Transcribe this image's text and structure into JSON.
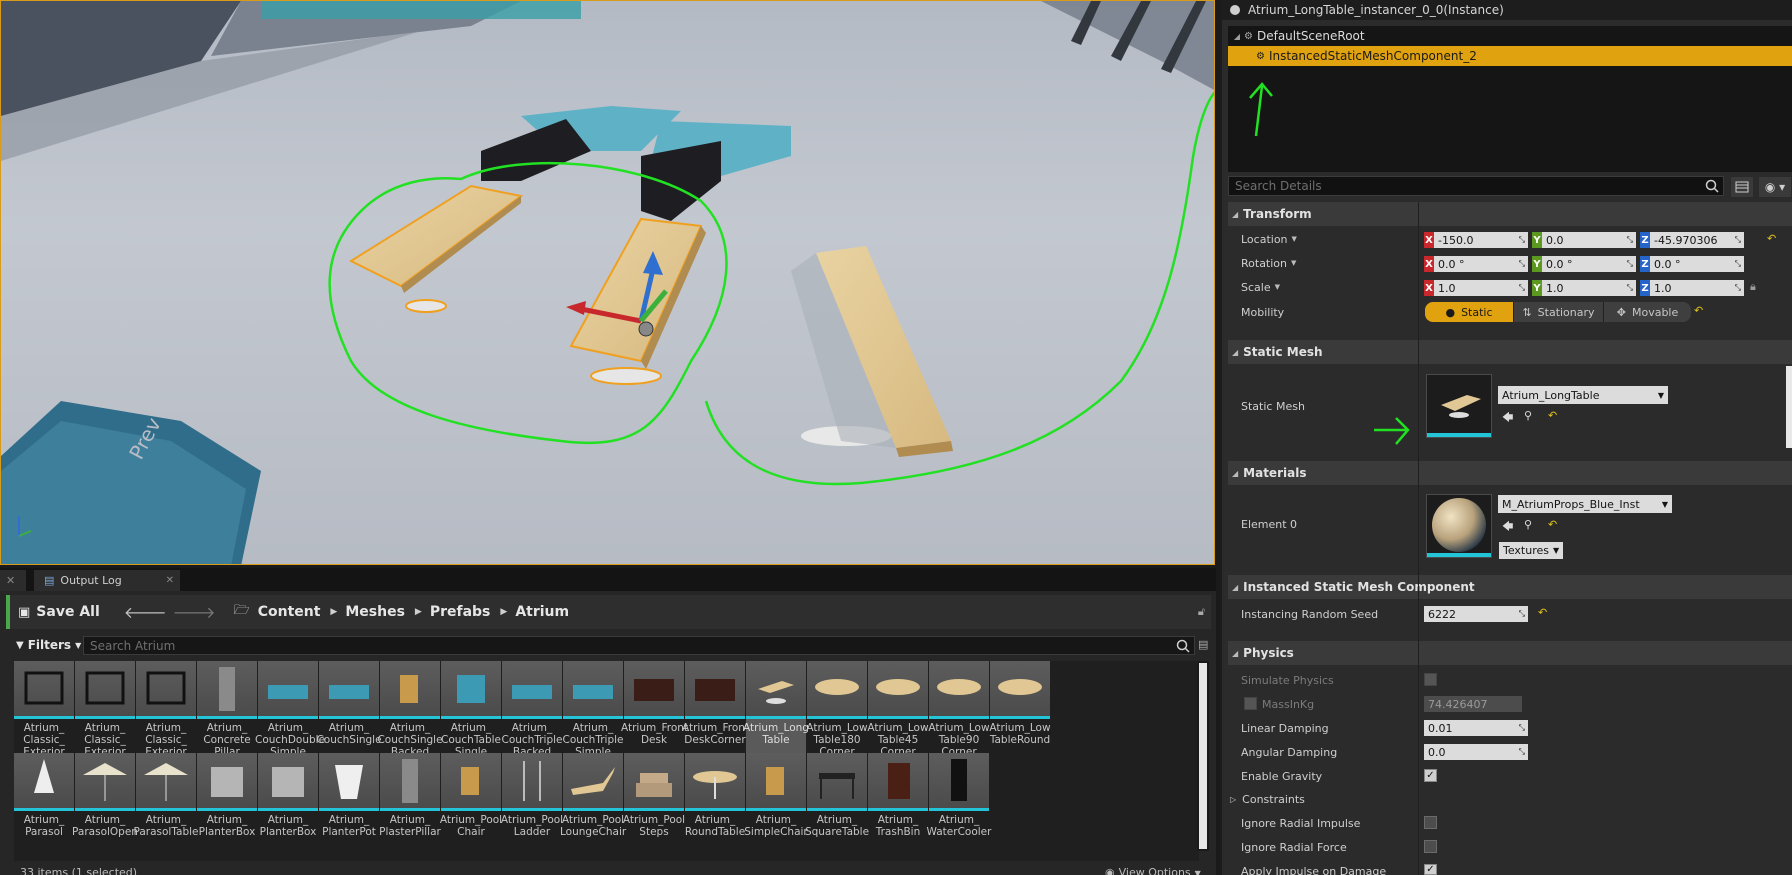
{
  "component_panel": {
    "actor_name": "Atrium_LongTable_instancer_0_0(Instance)",
    "tree": [
      {
        "label": "DefaultSceneRoot"
      },
      {
        "label": "InstancedStaticMeshComponent_2"
      }
    ]
  },
  "details": {
    "search_placeholder": "Search Details",
    "transform": {
      "header": "Transform",
      "location_label": "Location",
      "rotation_label": "Rotation",
      "scale_label": "Scale",
      "mobility_label": "Mobility",
      "location": {
        "x": "-150.0",
        "y": "0.0",
        "z": "-45.970306"
      },
      "rotation": {
        "x": "0.0 °",
        "y": "0.0 °",
        "z": "0.0 °"
      },
      "scale": {
        "x": "1.0",
        "y": "1.0",
        "z": "1.0"
      },
      "mobility_options": [
        "Static",
        "Stationary",
        "Movable"
      ],
      "mobility_selected": "Static"
    },
    "static_mesh": {
      "header": "Static Mesh",
      "label": "Static Mesh",
      "value": "Atrium_LongTable"
    },
    "materials": {
      "header": "Materials",
      "element_label": "Element 0",
      "value": "M_AtriumProps_Blue_Inst",
      "textures_label": "Textures"
    },
    "instanced": {
      "header": "Instanced Static Mesh Component",
      "seed_label": "Instancing Random Seed",
      "seed_value": "6222"
    },
    "physics": {
      "header": "Physics",
      "simulate_label": "Simulate Physics",
      "mass_label": "MassInKg",
      "mass_value": "74.426407",
      "linear_label": "Linear Damping",
      "linear_value": "0.01",
      "angular_label": "Angular Damping",
      "angular_value": "0.0",
      "gravity_label": "Enable Gravity",
      "constraints_label": "Constraints",
      "radial_impulse_label": "Ignore Radial Impulse",
      "radial_force_label": "Ignore Radial Force",
      "apply_impulse_label": "Apply Impulse on Damage"
    }
  },
  "tabs": {
    "output_log": "Output Log"
  },
  "content_browser": {
    "save_all": "Save All",
    "breadcrumbs": [
      "Content",
      "Meshes",
      "Prefabs",
      "Atrium"
    ],
    "filters_label": "Filters",
    "search_placeholder": "Search Atrium",
    "status": "33 items (1 selected)",
    "view_options": "View Options",
    "assets_row1": [
      "Atrium_\nClassic_\nExterior",
      "Atrium_\nClassic_\nExterior",
      "Atrium_\nClassic_\nExterior",
      "Atrium_\nConcrete\nPillar",
      "Atrium_\nCouchDouble\nSimple",
      "Atrium_\nCouchSingle",
      "Atrium_\nCouchSingle\nBacked",
      "Atrium_\nCouchTable\nSingle",
      "Atrium_\nCouchTriple\nBacked",
      "Atrium_\nCouchTriple\nSimple",
      "Atrium_Front\nDesk",
      "Atrium_Front\nDeskCorner",
      "Atrium_Long\nTable",
      "Atrium_Low\nTable180\nCorner",
      "Atrium_Low\nTable45\nCorner",
      "Atrium_Low\nTable90\nCorner",
      "Atrium_Low\nTableRound"
    ],
    "assets_row2": [
      "Atrium_\nParasol",
      "Atrium_\nParasolOpen",
      "Atrium_\nParasolTable",
      "Atrium_\nPlanterBox",
      "Atrium_\nPlanterBox",
      "Atrium_\nPlanterPot",
      "Atrium_\nPlasterPillar",
      "Atrium_Pool\nChair",
      "Atrium_Pool\nLadder",
      "Atrium_Pool\nLoungeChair",
      "Atrium_Pool\nSteps",
      "Atrium_\nRoundTable",
      "Atrium_\nSimpleChair",
      "Atrium_\nSquareTable",
      "Atrium_\nTrashBin",
      "Atrium_\nWaterCooler"
    ],
    "selected_index": 12
  },
  "colors": {
    "selection": "#e1a20f",
    "annotation": "#22e022",
    "asset_bar": "#23c4d8"
  }
}
